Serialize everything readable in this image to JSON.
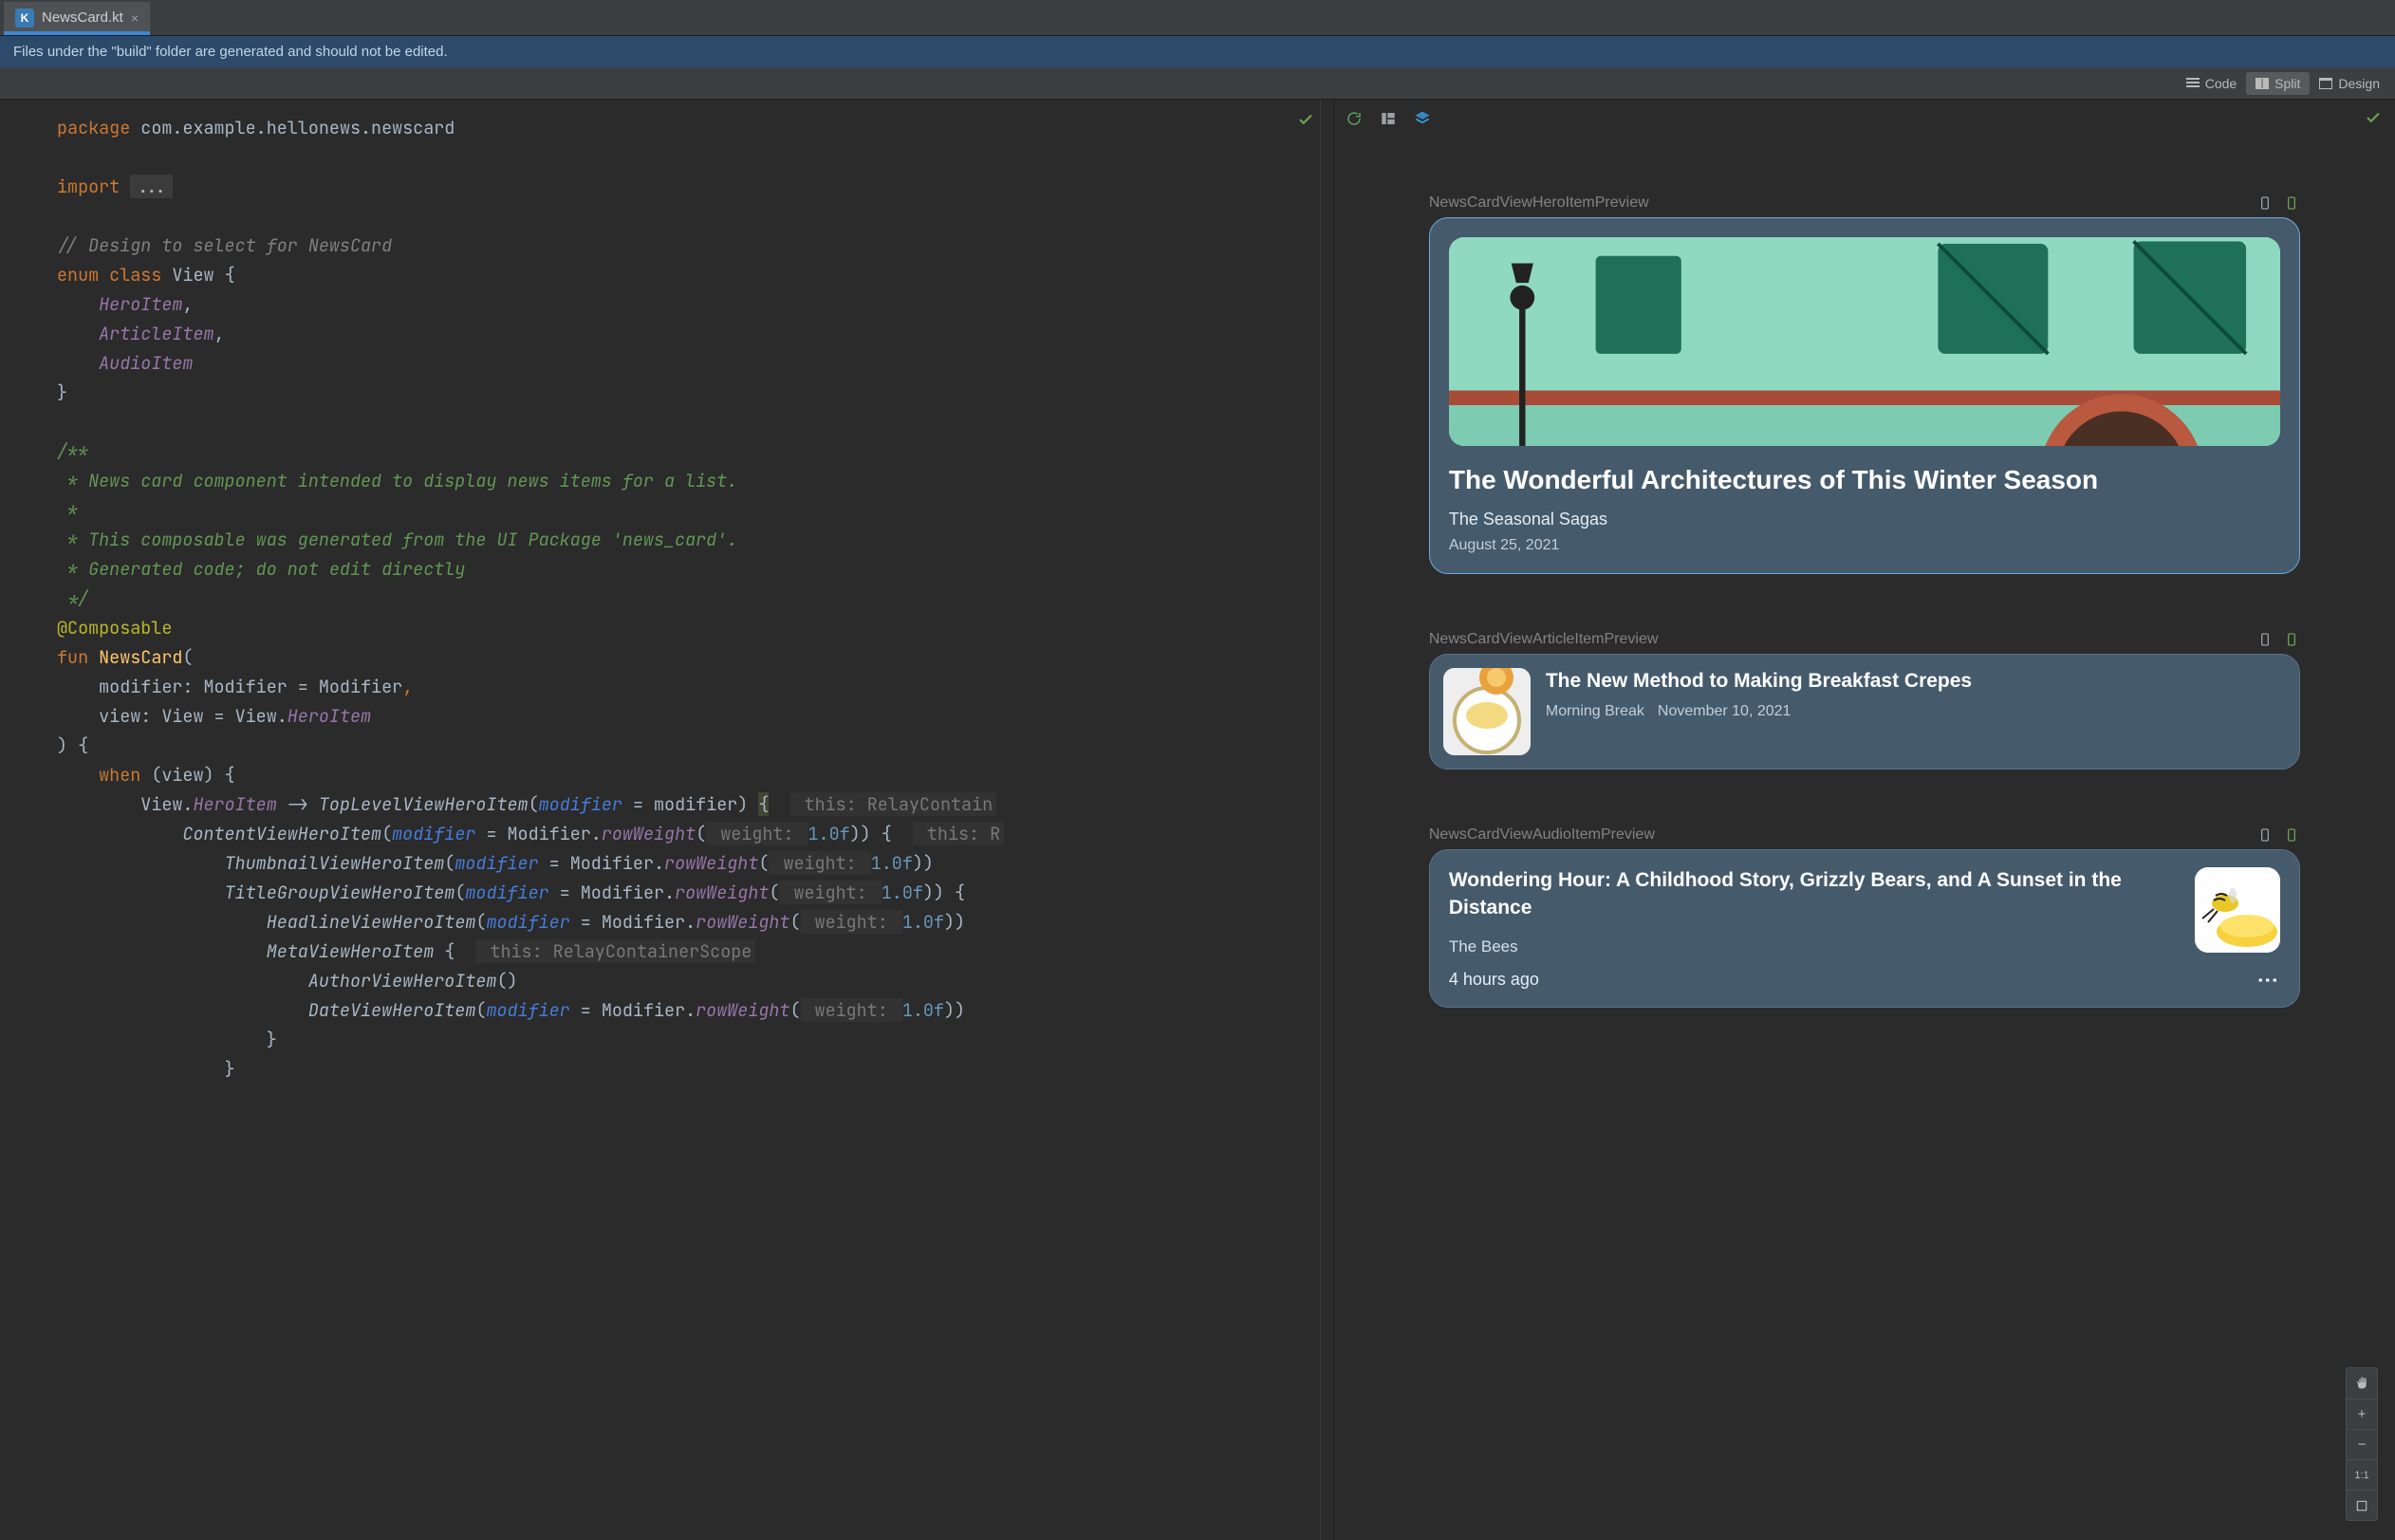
{
  "tab": {
    "filename": "NewsCard.kt"
  },
  "banner": {
    "text": "Files under the \"build\" folder are generated and should not be edited."
  },
  "modes": {
    "code": "Code",
    "split": "Split",
    "design": "Design"
  },
  "code": {
    "line1_kw": "package",
    "line1_pkg": " com.example.hellonews.newscard",
    "line3_kw": "import",
    "line3_ell": "...",
    "line5_cmt": "// Design to select for NewsCard",
    "line6_kw": "enum class",
    "line6_cls": " View {",
    "line7_enum": "HeroItem",
    "line7_comma": ",",
    "line8_enum": "ArticleItem",
    "line8_comma": ",",
    "line9_enum": "AudioItem",
    "line10_close": "}",
    "doc1": "/**",
    "doc2": " * News card component intended to display news items for a list.",
    "doc3": " *",
    "doc4": " * This composable was generated from the UI Package 'news_card'.",
    "doc5": " * Generated code; do not edit directly",
    "doc6": " */",
    "ann": "@Composable",
    "fun_kw": "fun",
    "fun_name": " NewsCard",
    "fun_open": "(",
    "p1": "modifier: Modifier = Modifier",
    "p1_comma": ",",
    "p2a": "view: View = View.",
    "p2b": "HeroItem",
    "close_paren": ") {",
    "when_kw": "when",
    "when_rest": " (view) {",
    "c1a": "View.",
    "c1b": "HeroItem",
    "c1c": " -> ",
    "c1d": "TopLevelViewHeroItem",
    "c1e": "(",
    "c1f": "modifier",
    "c1g": " = modifier) ",
    "c1h": "{",
    "c1hint": " this: RelayContain",
    "c2a": "ContentViewHeroItem",
    "c2b": "(",
    "c2c": "modifier",
    "c2d": " = Modifier.",
    "c2e": "rowWeight",
    "c2f": "(",
    "c2g": " weight: ",
    "c2h": "1.0f",
    "c2i": ")) {",
    "c2hint": " this: R",
    "c3a": "ThumbnailViewHeroItem",
    "c3b": "(",
    "c3c": "modifier",
    "c3d": " = Modifier.",
    "c3e": "rowWeight",
    "c3f": "(",
    "c3g": " weight: ",
    "c3h": "1.0f",
    "c3i": "))",
    "c4a": "TitleGroupViewHeroItem",
    "c4b": "(",
    "c4c": "modifier",
    "c4d": " = Modifier.",
    "c4e": "rowWeight",
    "c4f": "(",
    "c4g": " weight: ",
    "c4h": "1.0f",
    "c4i": ")) ",
    "c4j": "{",
    "c5a": "HeadlineViewHeroItem",
    "c5b": "(",
    "c5c": "modifier",
    "c5d": " = Modifier.",
    "c5e": "rowWeight",
    "c5f": "(",
    "c5g": " weight: ",
    "c5h": "1.0f",
    "c5i": "))",
    "c6a": "MetaViewHeroItem",
    "c6b": " {",
    "c6hint": " this: RelayContainerScope",
    "c7a": "AuthorViewHeroItem",
    "c7b": "()",
    "c8a": "DateViewHeroItem",
    "c8b": "(",
    "c8c": "modifier",
    "c8d": " = Modifier.",
    "c8e": "rowWeight",
    "c8f": "(",
    "c8g": " weight: ",
    "c8h": "1.0f",
    "c8i": "))",
    "c9": "}",
    "c10": "}"
  },
  "previews": {
    "hero": {
      "label": "NewsCardViewHeroItemPreview",
      "title": "The Wonderful Architectures of This Winter Season",
      "author": "The Seasonal Sagas",
      "date": "August 25, 2021"
    },
    "article": {
      "label": "NewsCardViewArticleItemPreview",
      "title": "The New Method to Making Breakfast Crepes",
      "author": "Morning Break",
      "date": "November 10, 2021"
    },
    "audio": {
      "label": "NewsCardViewAudioItemPreview",
      "title": "Wondering Hour: A Childhood Story, Grizzly Bears, and A Sunset in the Distance",
      "author": "The Bees",
      "time": "4 hours ago"
    }
  },
  "zoom": {
    "ratio": "1:1"
  }
}
